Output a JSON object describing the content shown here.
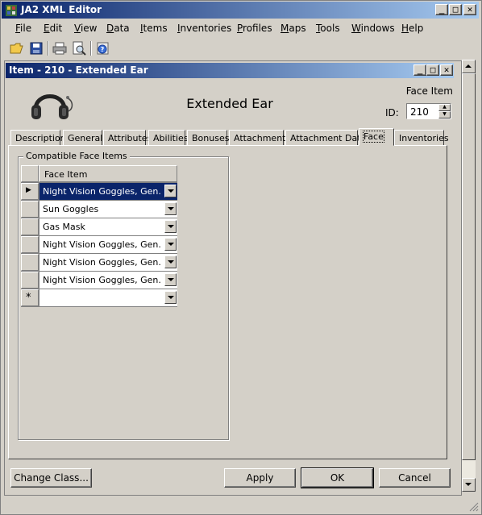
{
  "app": {
    "title": "JA2 XML Editor",
    "icon": "app-icon"
  },
  "menu": [
    {
      "pre": "",
      "u": "F",
      "post": "ile"
    },
    {
      "pre": "",
      "u": "E",
      "post": "dit"
    },
    {
      "pre": "",
      "u": "V",
      "post": "iew"
    },
    {
      "pre": "",
      "u": "D",
      "post": "ata"
    },
    {
      "pre": "",
      "u": "I",
      "post": "tems"
    },
    {
      "pre": "",
      "u": "I",
      "post": "nventories"
    },
    {
      "pre": "",
      "u": "P",
      "post": "rofiles"
    },
    {
      "pre": "",
      "u": "M",
      "post": "aps"
    },
    {
      "pre": "",
      "u": "T",
      "post": "ools"
    },
    {
      "pre": "",
      "u": "W",
      "post": "indows"
    },
    {
      "pre": "",
      "u": "H",
      "post": "elp"
    }
  ],
  "toolbar": [
    "open-folder-icon",
    "save-icon",
    "print-icon",
    "print-preview-icon",
    "help-icon"
  ],
  "child": {
    "title": "Item - 210 - Extended Ear",
    "item_name": "Extended Ear",
    "item_type_label": "Face Item",
    "id_label": "ID:",
    "id_value": "210"
  },
  "tabs": [
    {
      "label": "Description",
      "active": false
    },
    {
      "label": "General",
      "active": false
    },
    {
      "label": "Attributes",
      "active": false
    },
    {
      "label": "Abilities",
      "active": false
    },
    {
      "label": "Bonuses",
      "active": false
    },
    {
      "label": "Attachments",
      "active": false
    },
    {
      "label": "Attachment Data",
      "active": false
    },
    {
      "label": "Face",
      "active": true
    },
    {
      "label": "Inventories",
      "active": false
    }
  ],
  "face_panel": {
    "group_title": "Compatible Face Items",
    "column_header": "Face Item",
    "rows": [
      "Night Vision Goggles, Gen. I",
      "Sun Goggles",
      "Gas Mask",
      "Night Vision Goggles, Gen. II",
      "Night Vision Goggles, Gen. III",
      "Night Vision Goggles, Gen. IV"
    ],
    "new_row_marker": "*",
    "current_row_marker": "▶"
  },
  "buttons": {
    "change_class": "Change Class...",
    "apply": "Apply",
    "ok": "OK",
    "cancel": "Cancel"
  },
  "colors": {
    "title_active": "#0a246a",
    "title_gradient_end": "#a6caf0",
    "face": "#d4d0c8",
    "selection": "#0a246a"
  }
}
